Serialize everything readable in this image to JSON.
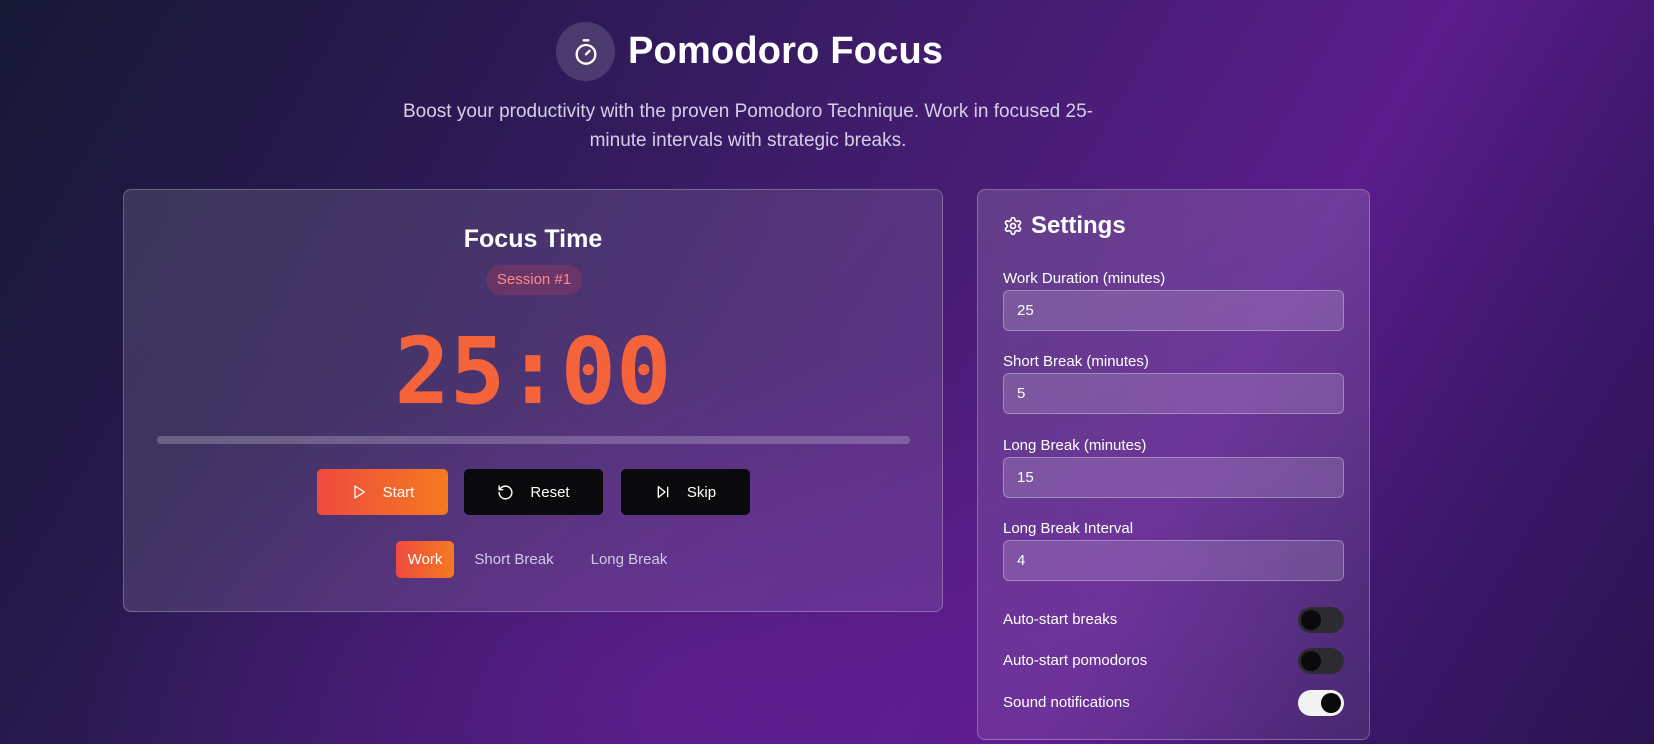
{
  "header": {
    "logo_icon": "timer-icon",
    "title": "Pomodoro Focus",
    "subtitle_line1": "Boost your productivity with the proven Pomodoro Technique. Work in focused 25-",
    "subtitle_line2": "minute intervals with strategic breaks."
  },
  "timer": {
    "mode_title": "Focus Time",
    "session_badge": "Session #1",
    "time": "25:00",
    "progress": 0,
    "accent_color": "#f4633a",
    "controls": {
      "start_label": "Start",
      "start_icon": "play-icon",
      "reset_label": "Reset",
      "reset_icon": "rotate-ccw-icon",
      "skip_label": "Skip",
      "skip_icon": "skip-forward-icon"
    },
    "tabs": {
      "work": "Work",
      "short_break": "Short Break",
      "long_break": "Long Break",
      "selected": "Work"
    }
  },
  "settings": {
    "title": "Settings",
    "icon": "gear-icon",
    "work_duration": {
      "label": "Work Duration (minutes)",
      "value": "25"
    },
    "short_break": {
      "label": "Short Break (minutes)",
      "value": "5"
    },
    "long_break": {
      "label": "Long Break (minutes)",
      "value": "15"
    },
    "long_break_interval": {
      "label": "Long Break Interval",
      "value": "4"
    },
    "toggles": {
      "auto_start_breaks": {
        "label": "Auto-start breaks",
        "on": false
      },
      "auto_start_pomodoros": {
        "label": "Auto-start pomodoros",
        "on": false
      },
      "sound_notifications": {
        "label": "Sound notifications",
        "on": true
      }
    }
  }
}
